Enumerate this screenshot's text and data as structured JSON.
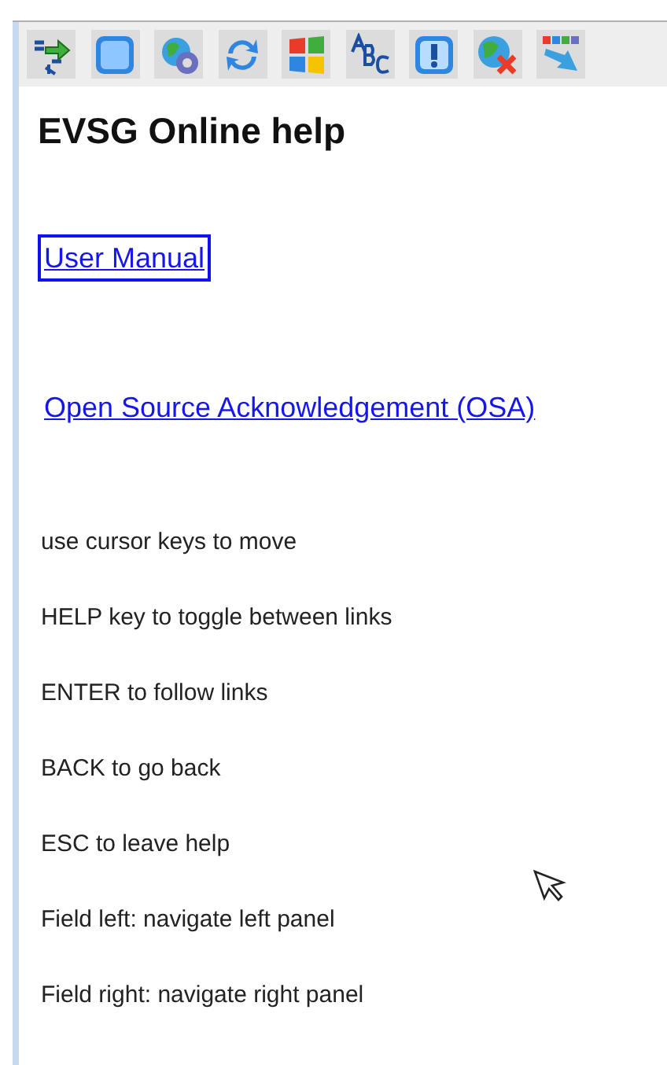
{
  "title": "EVSG Online help",
  "links": [
    {
      "label": "User Manual",
      "selected": true
    },
    {
      "label": "Open Source Acknowledgement (OSA)",
      "selected": false
    }
  ],
  "instructions": [
    "use cursor keys to move",
    "HELP key to toggle between links",
    "ENTER to follow links",
    "BACK to go back",
    "ESC to leave help",
    "Field left: navigate left panel",
    "Field right: navigate right panel"
  ]
}
